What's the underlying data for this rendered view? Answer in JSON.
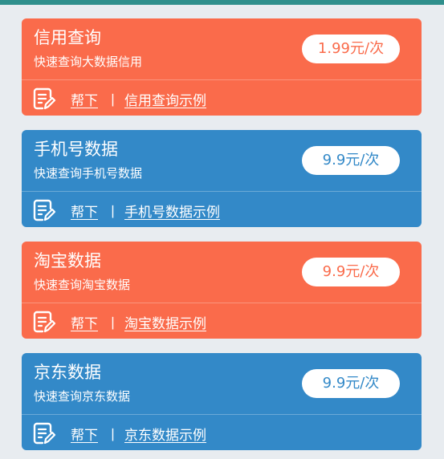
{
  "colors": {
    "orange": "#fa6b4b",
    "blue": "#3389c8",
    "background": "#e8ecf0"
  },
  "cards": [
    {
      "title": "信用查询",
      "subtitle": "快速查询大数据信用",
      "price": "1.99元/次",
      "help_label": "帮下",
      "separator": "丨",
      "example_link": "信用查询示例",
      "color": "orange",
      "icon": "edit-document-icon"
    },
    {
      "title": "手机号数据",
      "subtitle": "快速查询手机号数据",
      "price": "9.9元/次",
      "help_label": "帮下",
      "separator": "丨",
      "example_link": "手机号数据示例",
      "color": "blue",
      "icon": "edit-document-icon"
    },
    {
      "title": "淘宝数据",
      "subtitle": "快速查询淘宝数据",
      "price": "9.9元/次",
      "help_label": "帮下",
      "separator": "丨",
      "example_link": "淘宝数据示例",
      "color": "orange",
      "icon": "edit-document-icon"
    },
    {
      "title": "京东数据",
      "subtitle": "快速查询京东数据",
      "price": "9.9元/次",
      "help_label": "帮下",
      "separator": "丨",
      "example_link": "京东数据示例",
      "color": "blue",
      "icon": "edit-document-icon"
    }
  ]
}
